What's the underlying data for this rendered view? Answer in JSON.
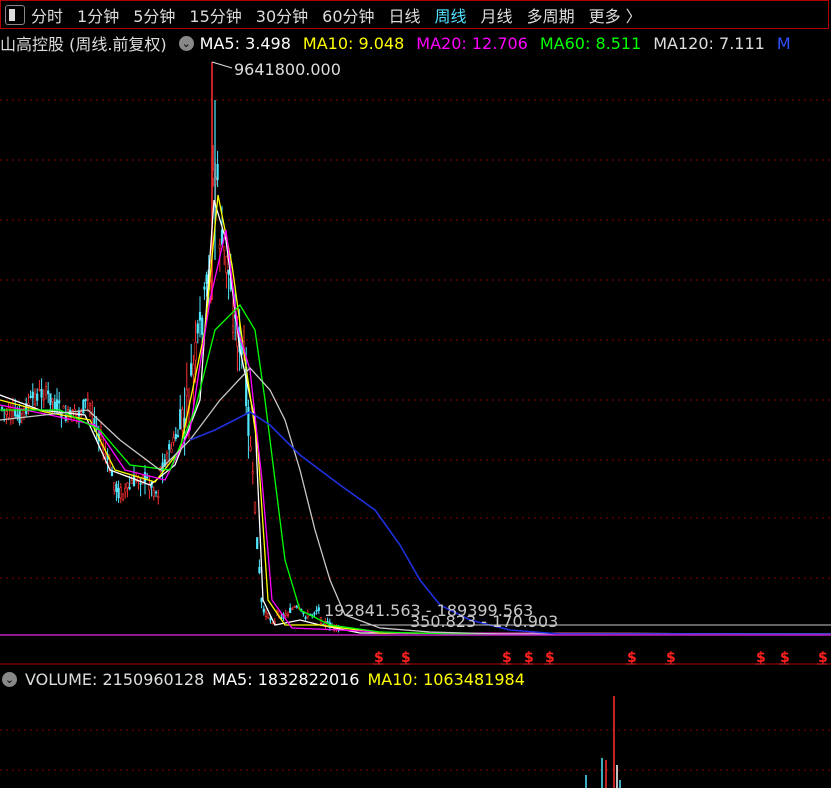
{
  "toolbar": {
    "periods": [
      "分时",
      "1分钟",
      "5分钟",
      "15分钟",
      "30分钟",
      "60分钟",
      "日线",
      "周线",
      "月线",
      "多周期",
      "更多 〉"
    ],
    "active": "周线"
  },
  "chart_header": {
    "title": "山高控股 (周线.前复权)",
    "ma": [
      {
        "label": "MA5: 3.498",
        "color": "#ffffff"
      },
      {
        "label": "MA10: 9.048",
        "color": "#ffff00"
      },
      {
        "label": "MA20: 12.706",
        "color": "#ff00ff"
      },
      {
        "label": "MA60: 8.511",
        "color": "#00ff00"
      },
      {
        "label": "MA120: 7.111",
        "color": "#dddddd"
      },
      {
        "label": "M",
        "color": "#3050ff"
      }
    ]
  },
  "annotations": {
    "peak": "9641800.000",
    "range1": "192841.563 - 189399.563",
    "range2": "350.823 - 170.903"
  },
  "volume_header": {
    "volume": "VOLUME: 2150960128",
    "ma5": "MA5: 1832822016",
    "ma10": "MA10: 1063481984",
    "ma5_color": "#ffffff",
    "ma10_color": "#ffff00"
  },
  "markers": {
    "symbol": "$",
    "color": "#ff2020"
  },
  "colors": {
    "up": "#ff3030",
    "down": "#50e8ff",
    "grid": "#8a0000",
    "background": "#000000"
  }
}
